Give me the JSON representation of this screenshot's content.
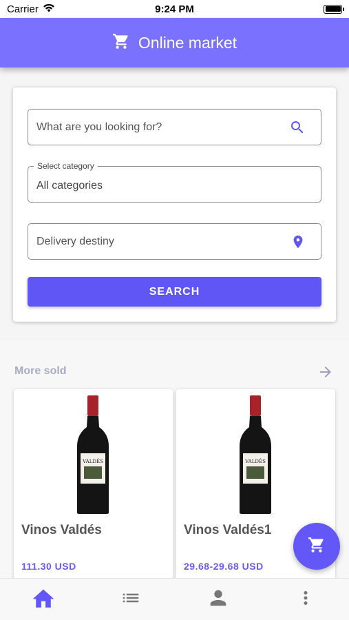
{
  "status": {
    "carrier": "Carrier",
    "time": "9:24 PM"
  },
  "appbar": {
    "title": "Online market",
    "icon": "cart-icon"
  },
  "search": {
    "query_placeholder": "What are you looking for?",
    "category_label": "Select category",
    "category_value": "All categories",
    "delivery_placeholder": "Delivery destiny",
    "button_label": "SEARCH"
  },
  "section": {
    "title": "More sold"
  },
  "products": [
    {
      "name": "Vinos Valdés",
      "price": "111.30 USD",
      "label_text": "VALDÉS"
    },
    {
      "name": "Vinos Valdés1",
      "price": "29.68-29.68 USD",
      "label_text": "VALDÉS"
    }
  ],
  "nav": {
    "tabs": [
      "home-icon",
      "list-icon",
      "person-icon",
      "more-vert-icon"
    ],
    "active": "home-icon"
  },
  "colors": {
    "primary": "#7a72ff",
    "button": "#6055f5",
    "accent": "#6a5cf0",
    "nav_active": "#6358f7",
    "nav_inactive": "#777777"
  }
}
